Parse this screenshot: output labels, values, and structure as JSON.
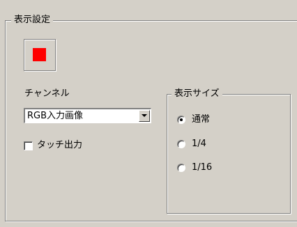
{
  "display_settings": {
    "title": "表示設定",
    "color_button": {
      "color": "#ff0000"
    },
    "channel": {
      "label": "チャンネル",
      "selected": "RGB入力画像"
    },
    "touch_output": {
      "label": "タッチ出力",
      "checked": false
    },
    "display_size": {
      "title": "表示サイズ",
      "options": [
        {
          "label": "通常",
          "selected": true
        },
        {
          "label": "1/4",
          "selected": false
        },
        {
          "label": "1/16",
          "selected": false
        }
      ]
    }
  },
  "colors": {
    "panel_background": "#d4d0c8",
    "swatch": "#ff0000"
  }
}
